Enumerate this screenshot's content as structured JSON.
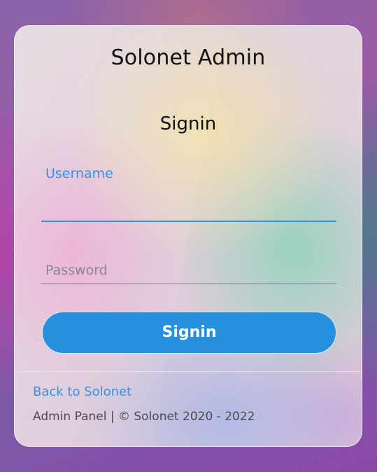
{
  "app": {
    "title": "Solonet Admin"
  },
  "form": {
    "title": "Signin",
    "username": {
      "label": "Username",
      "value": ""
    },
    "password": {
      "placeholder": "Password",
      "value": ""
    },
    "submit_label": "Signin"
  },
  "footer": {
    "back_link": "Back to Solonet",
    "copyright": "Admin Panel | © Solonet 2020 - 2022"
  },
  "colors": {
    "accent": "#3b8fe3",
    "button": "#2690dc",
    "text": "#111111",
    "muted": "#4f4a52"
  }
}
